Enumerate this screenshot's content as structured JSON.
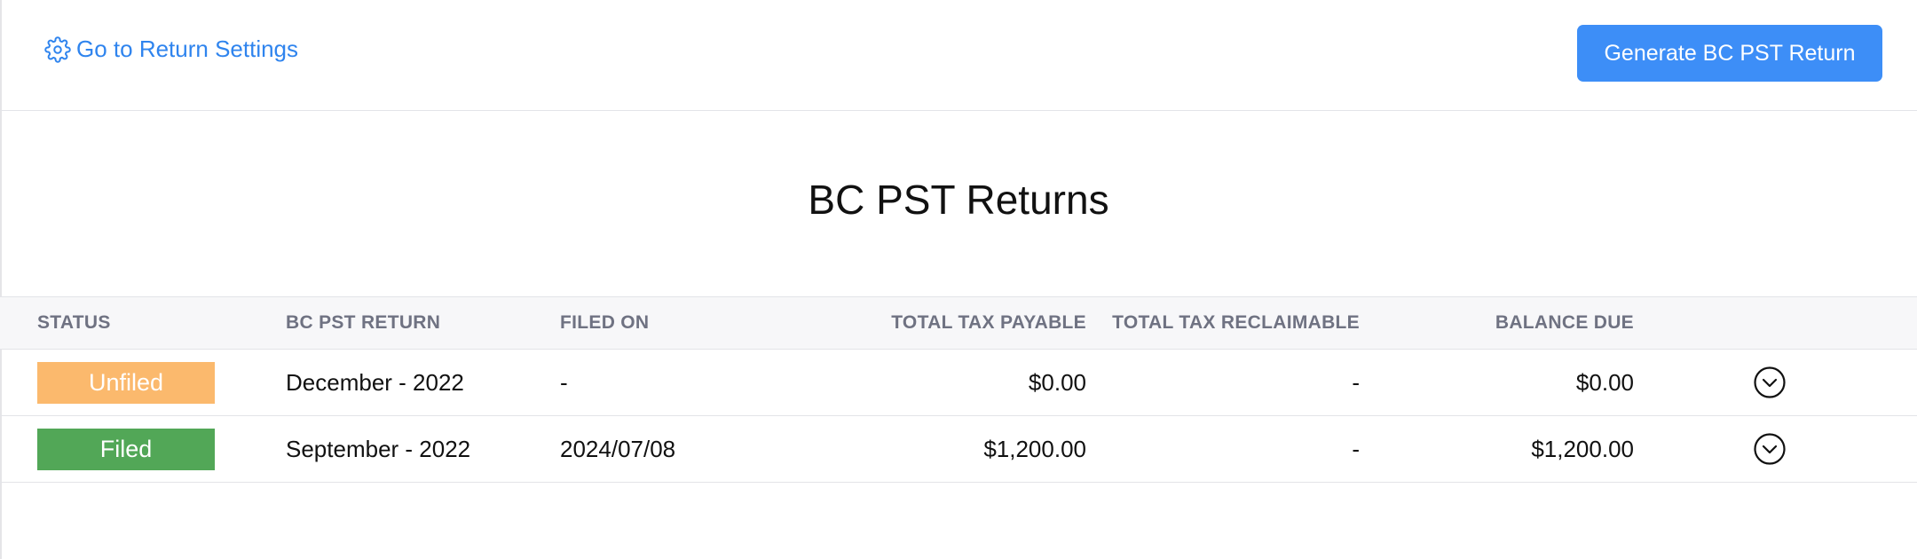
{
  "header": {
    "settings_link_label": "Go to Return Settings",
    "settings_icon": "gear-icon",
    "generate_button_label": "Generate BC PST Return",
    "accent_color": "#3d8ef7"
  },
  "page_title": "BC PST Returns",
  "table": {
    "columns": [
      "STATUS",
      "BC PST RETURN",
      "FILED ON",
      "TOTAL TAX PAYABLE",
      "TOTAL TAX RECLAIMABLE",
      "BALANCE DUE"
    ],
    "rows": [
      {
        "status": "Unfiled",
        "status_color": "#fbb96d",
        "period": "December - 2022",
        "filed_on": "-",
        "total_tax_payable": "$0.00",
        "total_tax_reclaimable": "-",
        "balance_due": "$0.00",
        "action_icon": "chevron-down-circle-icon"
      },
      {
        "status": "Filed",
        "status_color": "#52a757",
        "period": "September - 2022",
        "filed_on": "2024/07/08",
        "total_tax_payable": "$1,200.00",
        "total_tax_reclaimable": "-",
        "balance_due": "$1,200.00",
        "action_icon": "chevron-down-circle-icon"
      }
    ]
  }
}
